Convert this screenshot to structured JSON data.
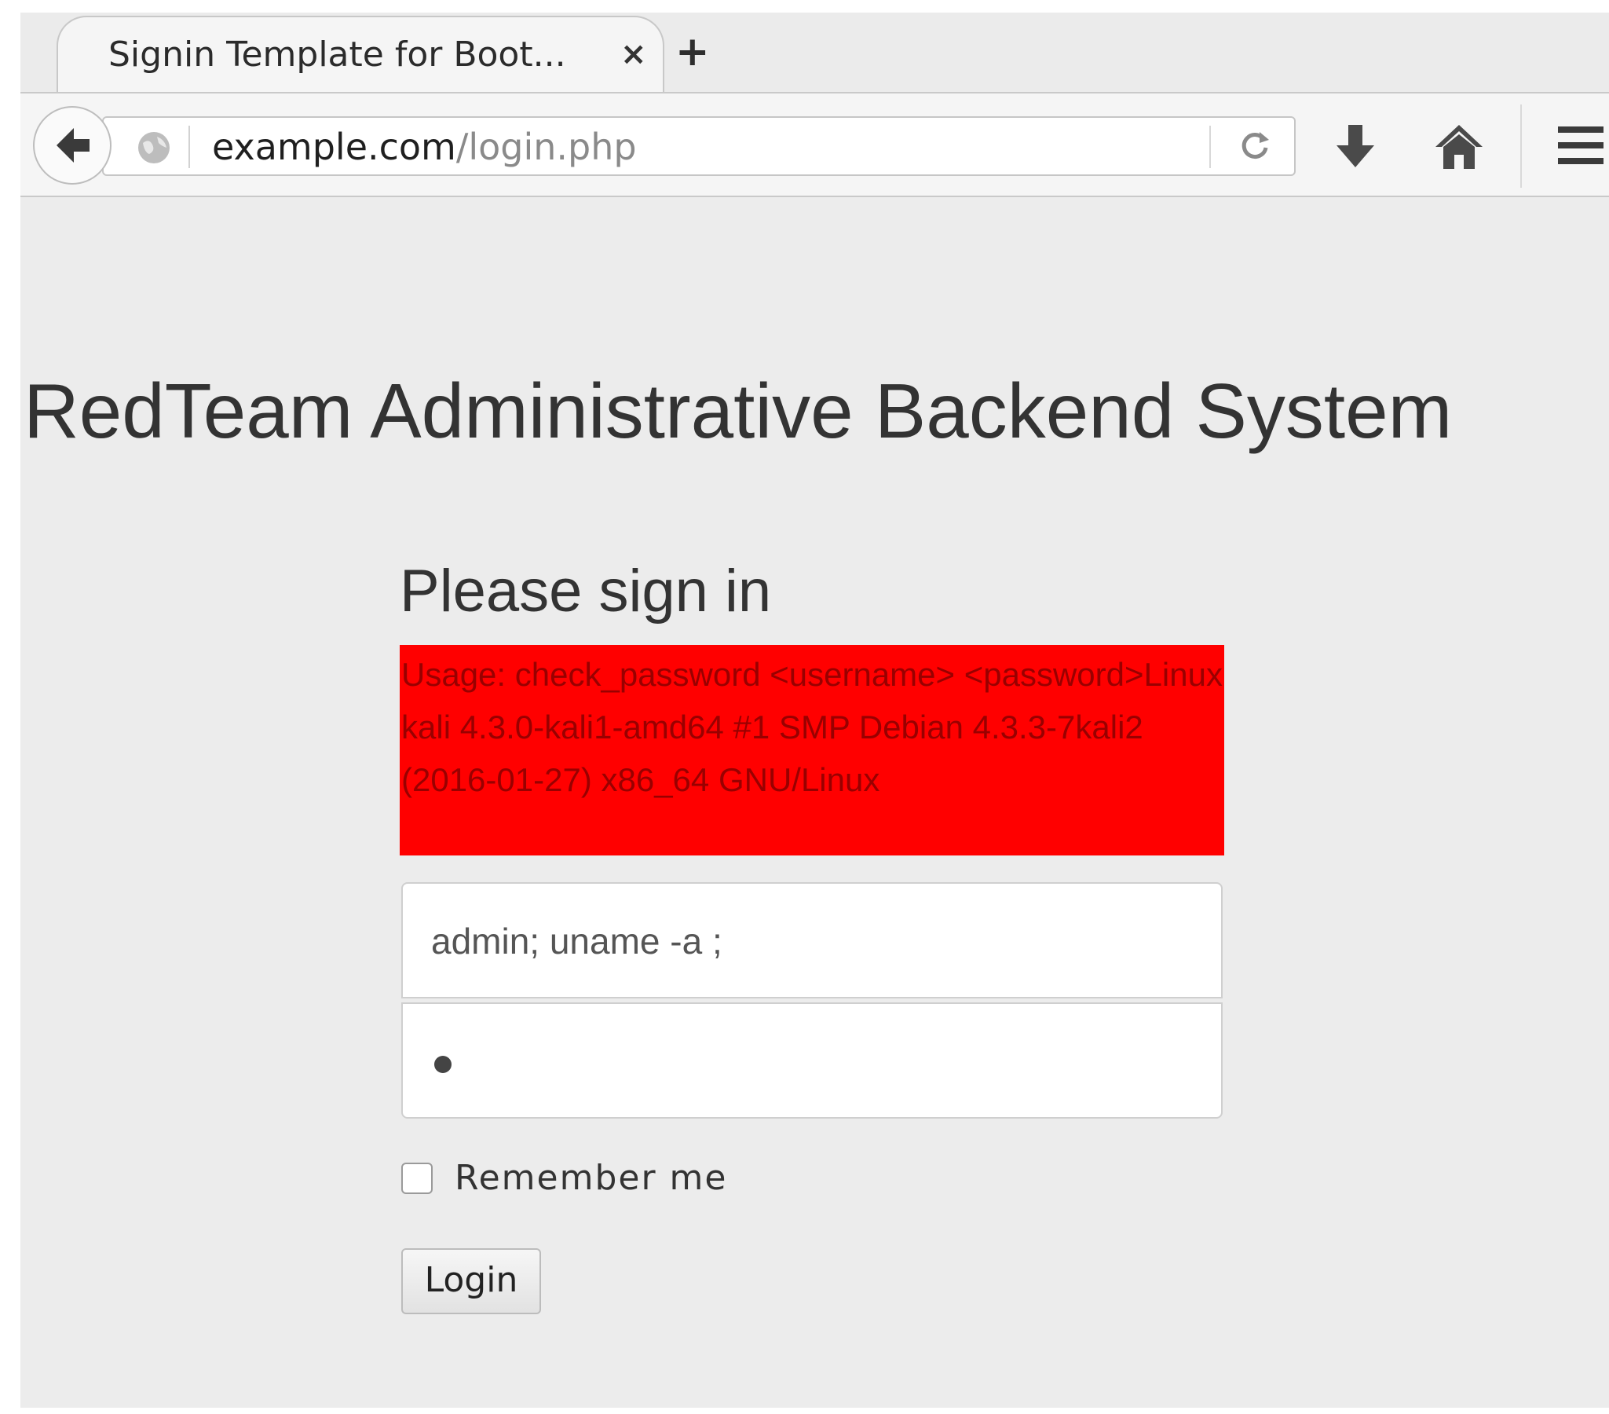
{
  "browser": {
    "tab_title": "Signin Template for Boot...",
    "tab_close_glyph": "×",
    "new_tab_glyph": "+",
    "url_host": "example.com",
    "url_path": "/login.php",
    "icons": [
      "back-arrow-icon",
      "globe-icon",
      "reload-icon",
      "download-icon",
      "home-icon",
      "menu-icon"
    ]
  },
  "page": {
    "title": "RedTeam Administrative Backend System",
    "signin_heading": "Please sign in",
    "error_message": "Usage: check_password <username> <password>Linux kali 4.3.0-kali1-amd64 #1 SMP Debian 4.3.3-7kali2 (2016-01-27) x86_64 GNU/Linux",
    "username_value": "admin; uname -a ;",
    "password_masked": "•",
    "remember_label": "Remember me",
    "remember_checked": false,
    "login_label": "Login"
  },
  "colors": {
    "error_background": "#ff0000",
    "error_text": "#990000",
    "page_background": "#ececec"
  }
}
